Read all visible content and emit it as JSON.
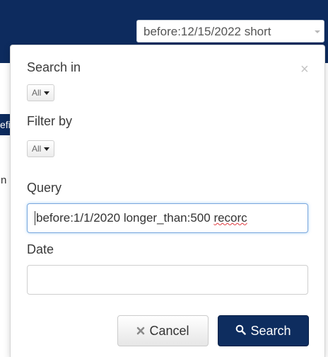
{
  "topbar": {
    "search_value": "before:12/15/2022 short",
    "search_caret_icon": "chevron-down-icon"
  },
  "background": {
    "left_tab_fragment": "efi",
    "left_text_fragment": "n",
    "right_text_fragment": "t"
  },
  "popover": {
    "close_label": "×",
    "search_in": {
      "label": "Search in",
      "value": "All"
    },
    "filter_by": {
      "label": "Filter by",
      "value": "All"
    },
    "query": {
      "label": "Query",
      "value_main": "before:1/1/2020 longer_than:500 ",
      "value_misspelled": "recorc"
    },
    "date": {
      "label": "Date",
      "value": ""
    },
    "buttons": {
      "cancel_label": "Cancel",
      "cancel_icon": "times-icon",
      "search_label": "Search",
      "search_icon": "search-icon"
    }
  },
  "colors": {
    "navbar": "#0d2b5e",
    "search_button": "#0e2d5f",
    "focus_border": "#7aa7de"
  }
}
